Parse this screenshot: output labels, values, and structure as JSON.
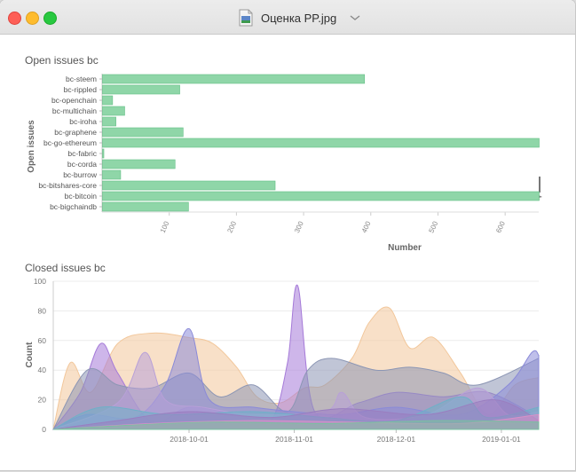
{
  "window": {
    "title": "Оценка PP.jpg",
    "icon": "image-file-icon",
    "colors": {
      "close": "#fe5f57",
      "minimize": "#febc2e",
      "maximize": "#28c840"
    }
  },
  "chart_data": [
    {
      "type": "bar",
      "orientation": "horizontal",
      "title": "Open issues bc",
      "xlabel": "Number",
      "ylabel": "Open issues",
      "xticks": [
        "100",
        "200",
        "300",
        "400",
        "500",
        "600"
      ],
      "xlim": [
        0,
        650
      ],
      "categories": [
        "bc-steem",
        "bc-rippled",
        "bc-openchain",
        "bc-multichain",
        "bc-iroha",
        "bc-graphene",
        "bc-go-ethereum",
        "bc-fabric",
        "bc-corda",
        "bc-burrow",
        "bc-bitshares-core",
        "bc-bitcoin",
        "bc-bigchaindb"
      ],
      "values": [
        390,
        115,
        15,
        33,
        20,
        120,
        650,
        2,
        108,
        27,
        257,
        650,
        128
      ],
      "color": "#8fd6a8"
    },
    {
      "type": "area",
      "title": "Closed issues bc",
      "xlabel": "",
      "ylabel": "Count",
      "xticks": [
        "2018-10-01",
        "2018-11-01",
        "2018-12-01",
        "2019-01-01"
      ],
      "yticks": [
        "0",
        "20",
        "40",
        "60",
        "80",
        "100"
      ],
      "ylim": [
        0,
        100
      ],
      "x_range": [
        "2018-08-22",
        "2019-01-12"
      ],
      "grid": true,
      "series": [
        {
          "color": "#f2c79b",
          "points": [
            [
              "2018-08-22",
              0
            ],
            [
              "2018-08-27",
              45
            ],
            [
              "2018-09-02",
              25
            ],
            [
              "2018-09-10",
              58
            ],
            [
              "2018-09-20",
              65
            ],
            [
              "2018-10-01",
              62
            ],
            [
              "2018-10-08",
              58
            ],
            [
              "2018-10-15",
              42
            ],
            [
              "2018-10-21",
              22
            ],
            [
              "2018-10-28",
              18
            ],
            [
              "2018-11-04",
              28
            ],
            [
              "2018-11-10",
              30
            ],
            [
              "2018-11-18",
              48
            ],
            [
              "2018-11-23",
              72
            ],
            [
              "2018-11-29",
              82
            ],
            [
              "2018-12-05",
              55
            ],
            [
              "2018-12-12",
              62
            ],
            [
              "2018-12-20",
              38
            ],
            [
              "2018-12-28",
              10
            ],
            [
              "2019-01-05",
              30
            ],
            [
              "2019-01-12",
              35
            ]
          ]
        },
        {
          "color": "#a57ad8",
          "points": [
            [
              "2018-08-22",
              0
            ],
            [
              "2018-08-30",
              25
            ],
            [
              "2018-09-05",
              58
            ],
            [
              "2018-09-10",
              38
            ],
            [
              "2018-09-20",
              5
            ],
            [
              "2018-10-01",
              15
            ],
            [
              "2018-10-15",
              10
            ],
            [
              "2018-10-25",
              6
            ],
            [
              "2018-10-30",
              45
            ],
            [
              "2018-11-02",
              97
            ],
            [
              "2018-11-07",
              12
            ],
            [
              "2018-11-20",
              18
            ],
            [
              "2018-12-01",
              25
            ],
            [
              "2018-12-15",
              22
            ],
            [
              "2018-12-28",
              25
            ],
            [
              "2019-01-12",
              8
            ]
          ]
        },
        {
          "color": "#8c96b4",
          "points": [
            [
              "2018-08-22",
              0
            ],
            [
              "2018-09-01",
              40
            ],
            [
              "2018-09-10",
              30
            ],
            [
              "2018-09-20",
              28
            ],
            [
              "2018-10-01",
              38
            ],
            [
              "2018-10-10",
              22
            ],
            [
              "2018-10-20",
              30
            ],
            [
              "2018-10-30",
              12
            ],
            [
              "2018-11-05",
              40
            ],
            [
              "2018-11-12",
              48
            ],
            [
              "2018-11-25",
              40
            ],
            [
              "2018-12-05",
              42
            ],
            [
              "2018-12-15",
              38
            ],
            [
              "2018-12-25",
              30
            ],
            [
              "2019-01-12",
              48
            ]
          ]
        },
        {
          "color": "#8a8ad8",
          "points": [
            [
              "2018-08-22",
              0
            ],
            [
              "2018-09-01",
              10
            ],
            [
              "2018-09-15",
              8
            ],
            [
              "2018-09-24",
              30
            ],
            [
              "2018-10-01",
              68
            ],
            [
              "2018-10-07",
              20
            ],
            [
              "2018-10-20",
              15
            ],
            [
              "2018-11-01",
              12
            ],
            [
              "2018-11-15",
              10
            ],
            [
              "2018-12-01",
              15
            ],
            [
              "2018-12-20",
              10
            ],
            [
              "2019-01-03",
              30
            ],
            [
              "2019-01-10",
              52
            ],
            [
              "2019-01-12",
              50
            ]
          ]
        },
        {
          "color": "#b8a0d8",
          "points": [
            [
              "2018-08-22",
              0
            ],
            [
              "2018-09-10",
              18
            ],
            [
              "2018-09-18",
              52
            ],
            [
              "2018-09-24",
              20
            ],
            [
              "2018-10-05",
              15
            ],
            [
              "2018-10-20",
              10
            ],
            [
              "2018-11-10",
              12
            ],
            [
              "2018-11-15",
              25
            ],
            [
              "2018-11-22",
              8
            ],
            [
              "2018-12-10",
              10
            ],
            [
              "2018-12-25",
              28
            ],
            [
              "2019-01-03",
              10
            ],
            [
              "2019-01-12",
              12
            ]
          ]
        },
        {
          "color": "#6fb0c8",
          "points": [
            [
              "2018-08-22",
              0
            ],
            [
              "2018-09-05",
              15
            ],
            [
              "2018-09-25",
              10
            ],
            [
              "2018-10-20",
              12
            ],
            [
              "2018-11-10",
              8
            ],
            [
              "2018-12-01",
              6
            ],
            [
              "2018-12-20",
              22
            ],
            [
              "2018-12-28",
              8
            ],
            [
              "2019-01-12",
              15
            ]
          ]
        },
        {
          "color": "#9a7ec0",
          "points": [
            [
              "2018-08-22",
              0
            ],
            [
              "2018-09-10",
              6
            ],
            [
              "2018-10-01",
              12
            ],
            [
              "2018-10-25",
              8
            ],
            [
              "2018-11-15",
              14
            ],
            [
              "2018-12-10",
              10
            ],
            [
              "2018-12-30",
              20
            ],
            [
              "2019-01-12",
              6
            ]
          ]
        },
        {
          "color": "#d890c8",
          "points": [
            [
              "2018-08-22",
              0
            ],
            [
              "2018-09-20",
              4
            ],
            [
              "2018-10-20",
              6
            ],
            [
              "2018-11-15",
              5
            ],
            [
              "2018-12-20",
              4
            ],
            [
              "2019-01-12",
              10
            ]
          ]
        },
        {
          "color": "#7ac0a0",
          "points": [
            [
              "2018-08-22",
              0
            ],
            [
              "2018-09-15",
              3
            ],
            [
              "2018-10-10",
              5
            ],
            [
              "2018-11-10",
              4
            ],
            [
              "2018-12-15",
              6
            ],
            [
              "2019-01-12",
              5
            ]
          ]
        }
      ]
    }
  ]
}
